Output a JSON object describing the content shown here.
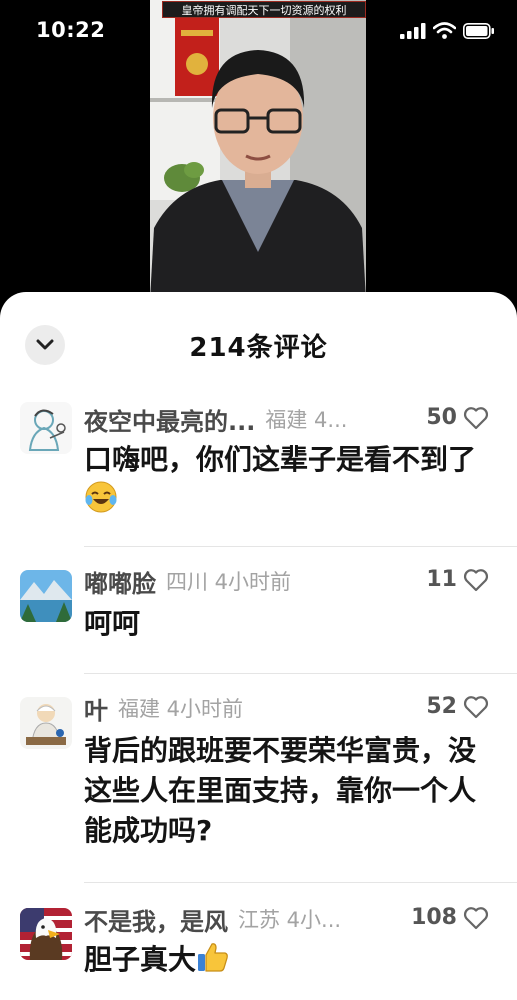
{
  "status_bar": {
    "time": "10:22"
  },
  "video": {
    "caption": "皇帝拥有调配天下一切资源的权利"
  },
  "sheet": {
    "title": "214条评论"
  },
  "comments": [
    {
      "name": "夜空中最亮的...",
      "meta": "福建 4...",
      "likes": "50",
      "text": "口嗨吧，你们这辈子是看不到了",
      "emoji": "face-with-tears-of-joy-icon"
    },
    {
      "name": "嘟嘟脸",
      "meta": "四川 4小时前",
      "likes": "11",
      "text": "呵呵"
    },
    {
      "name": "叶",
      "meta": "福建 4小时前",
      "likes": "52",
      "text": "背后的跟班要不要荣华富贵，没这些人在里面支持，靠你一个人能成功吗?"
    },
    {
      "name": "不是我，是风",
      "meta": "江苏 4小...",
      "likes": "108",
      "text": "胆子真大",
      "emoji": "thumbs-up-icon"
    }
  ]
}
